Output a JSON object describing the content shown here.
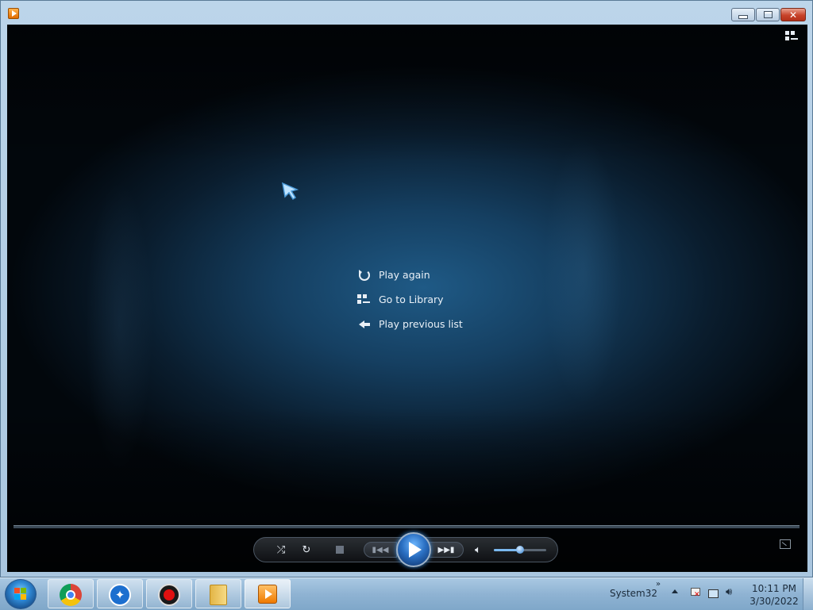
{
  "window": {
    "app_icon": "windows-media-player-icon",
    "buttons": [
      "minimize-icon",
      "maximize-icon",
      "close-icon"
    ]
  },
  "player": {
    "menu": [
      {
        "icon": "replay-icon",
        "label": "Play again"
      },
      {
        "icon": "library-icon",
        "label": "Go to Library"
      },
      {
        "icon": "back-arrow-icon",
        "label": "Play previous list"
      }
    ],
    "volume_level": 0.5
  },
  "taskbar": {
    "pinned": [
      "chrome-icon",
      "bluetooth-icon",
      "record-icon",
      "folder-icon",
      "media-player-icon"
    ],
    "toolbar_label": "System32",
    "toolbar_chevron": "»",
    "clock_time": "10:11 PM",
    "clock_date": "3/30/2022"
  },
  "colors": {
    "accent": "#2a6fc2",
    "background_glow": "#1f5a86"
  }
}
